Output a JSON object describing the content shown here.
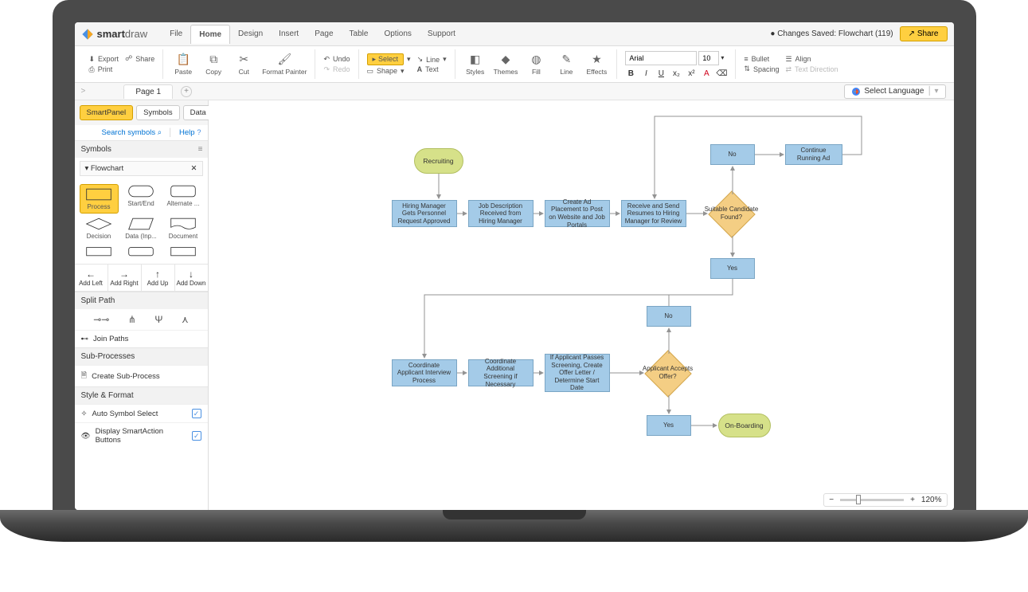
{
  "app": {
    "name": "smartdraw"
  },
  "menubar": {
    "items": [
      "File",
      "Home",
      "Design",
      "Insert",
      "Page",
      "Table",
      "Options",
      "Support"
    ],
    "active": "Home",
    "save_status": "Changes Saved: Flowchart (119)",
    "share_label": "Share"
  },
  "ribbon": {
    "export": "Export",
    "print": "Print",
    "share": "Share",
    "paste": "Paste",
    "copy": "Copy",
    "cut": "Cut",
    "format_painter": "Format Painter",
    "undo": "Undo",
    "redo": "Redo",
    "select": "Select",
    "shape": "Shape",
    "line": "Line",
    "text": "Text",
    "styles": "Styles",
    "themes": "Themes",
    "fill": "Fill",
    "line2": "Line",
    "effects": "Effects",
    "font_name": "Arial",
    "font_size": "10",
    "bold": "B",
    "italic": "I",
    "underline": "U",
    "bullet": "Bullet",
    "align": "Align",
    "spacing": "Spacing",
    "text_direction": "Text Direction"
  },
  "pages": {
    "page1": "Page 1",
    "lang": "Select Language"
  },
  "panel": {
    "tabs": [
      "SmartPanel",
      "Symbols",
      "Data"
    ],
    "active": "SmartPanel",
    "search": "Search symbols",
    "help": "Help",
    "symbols_header": "Symbols",
    "flowchart_header": "Flowchart",
    "shapes": [
      "Process",
      "Start/End",
      "Alternate ...",
      "Decision",
      "Data (Inp...",
      "Document"
    ],
    "add": [
      "Add Left",
      "Add Right",
      "Add Up",
      "Add Down"
    ],
    "split_header": "Split Path",
    "join_paths": "Join Paths",
    "sub_header": "Sub-Processes",
    "create_sub": "Create Sub-Process",
    "style_header": "Style & Format",
    "auto_symbol": "Auto Symbol Select",
    "display_smart": "Display SmartAction Buttons"
  },
  "flow": {
    "recruiting": "Recruiting",
    "p1": "Hiring Manager Gets Personnel Request Approved",
    "p2": "Job Description Received from Hiring Manager",
    "p3": "Create Ad Placement to Post on Website and Job Portals",
    "p4": "Receive and Send Resumes to Hiring Manager for Review",
    "d1": "Suitable Candidate Found?",
    "no1": "No",
    "yes1": "Yes",
    "continue": "Continue Running Ad",
    "p5": "Coordinate Applicant Interview Process",
    "p6": "Coordinate Additional Screening if Necessary",
    "p7": "If Applicant Passes Screening, Create Offer Letter / Determine Start Date",
    "d2": "Applicant Accepts Offer?",
    "no2": "No",
    "yes2": "Yes",
    "onboarding": "On-Boarding"
  },
  "zoom": "120%"
}
